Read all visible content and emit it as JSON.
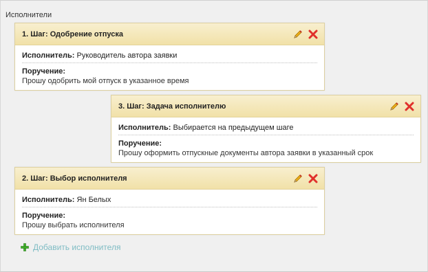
{
  "section": {
    "title": "Исполнители"
  },
  "steps": [
    {
      "title": "1.  Шаг: Одобрение отпуска",
      "executor_label": "Исполнитель:",
      "executor_value": "Руководитель автора заявки",
      "order_label": "Поручение:",
      "order_text": "Прошу одобрить мой отпуск в указанное время"
    },
    {
      "title": "3.  Шаг: Задача исполнителю",
      "executor_label": "Исполнитель:",
      "executor_value": "Выбирается на предыдущем шаге",
      "order_label": "Поручение:",
      "order_text": "Прошу оформить отпускные документы автора заявки в указанный срок"
    },
    {
      "title": "2.  Шаг: Выбор исполнителя",
      "executor_label": "Исполнитель:",
      "executor_value": "Ян Белых",
      "order_label": "Поручение:",
      "order_text": "Прошу выбрать исполнителя"
    }
  ],
  "actions": {
    "add_executor_label": "Добавить исполнителя"
  },
  "icons": {
    "edit": "pencil-icon",
    "delete": "close-icon",
    "add": "plus-icon"
  },
  "colors": {
    "header_top": "#f8efcf",
    "header_bottom": "#f1e1a8",
    "border": "#ddd0a0",
    "delete_red": "#e0302b",
    "add_green": "#3fae2a",
    "link": "#7fbcc4"
  }
}
